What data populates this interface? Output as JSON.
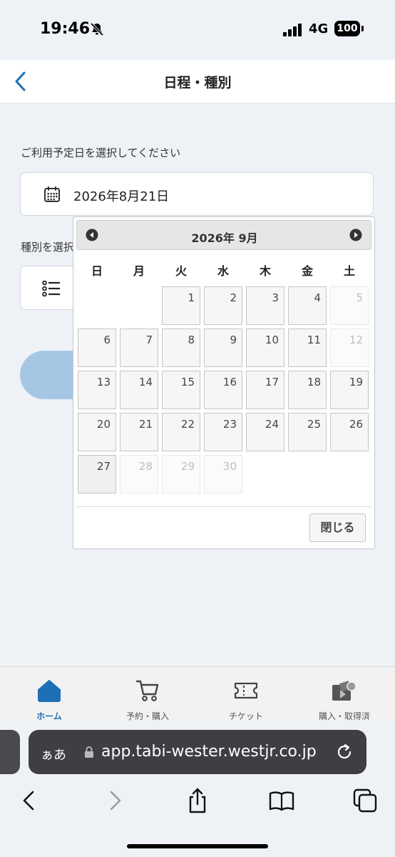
{
  "status_bar": {
    "time": "19:46",
    "network": "4G",
    "battery": "100"
  },
  "header": {
    "title": "日程・種別"
  },
  "form": {
    "date_label": "ご利用予定日を選択してください",
    "date_value": "2026年8月21日",
    "type_label": "種別を選択"
  },
  "datepicker": {
    "title": "2026年 9月",
    "weekdays": [
      "日",
      "月",
      "火",
      "水",
      "木",
      "金",
      "土"
    ],
    "days": [
      {
        "n": "1",
        "muted": false
      },
      {
        "n": "2",
        "muted": false
      },
      {
        "n": "3",
        "muted": false
      },
      {
        "n": "4",
        "muted": false
      },
      {
        "n": "5",
        "muted": true
      },
      {
        "n": "6",
        "muted": false
      },
      {
        "n": "7",
        "muted": false
      },
      {
        "n": "8",
        "muted": false
      },
      {
        "n": "9",
        "muted": false
      },
      {
        "n": "10",
        "muted": false
      },
      {
        "n": "11",
        "muted": false
      },
      {
        "n": "12",
        "muted": true
      },
      {
        "n": "13",
        "muted": false
      },
      {
        "n": "14",
        "muted": false
      },
      {
        "n": "15",
        "muted": false
      },
      {
        "n": "16",
        "muted": false
      },
      {
        "n": "17",
        "muted": false
      },
      {
        "n": "18",
        "muted": false
      },
      {
        "n": "19",
        "muted": false
      },
      {
        "n": "20",
        "muted": false
      },
      {
        "n": "21",
        "muted": false
      },
      {
        "n": "22",
        "muted": false
      },
      {
        "n": "23",
        "muted": false
      },
      {
        "n": "24",
        "muted": false
      },
      {
        "n": "25",
        "muted": false
      },
      {
        "n": "26",
        "muted": false
      },
      {
        "n": "27",
        "muted": false
      },
      {
        "n": "28",
        "muted": true
      },
      {
        "n": "29",
        "muted": true
      },
      {
        "n": "30",
        "muted": true
      }
    ],
    "close_label": "閉じる"
  },
  "bottom_nav": {
    "items": [
      {
        "label": "ホーム",
        "icon": "home-icon",
        "active": true
      },
      {
        "label": "予約・購入",
        "icon": "cart-icon",
        "active": false
      },
      {
        "label": "チケット",
        "icon": "ticket-icon",
        "active": false
      },
      {
        "label": "購入・取得済",
        "icon": "purchased-icon",
        "active": false
      }
    ]
  },
  "browser": {
    "aa_label": "ぁあ",
    "url": "app.tabi-wester.westjr.co.jp"
  },
  "colors": {
    "accent": "#1e6fb8",
    "primary_button": "#a6c7e4",
    "background": "#eef2f7"
  }
}
